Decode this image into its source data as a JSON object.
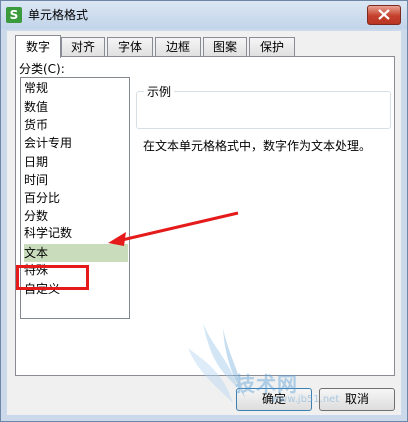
{
  "window": {
    "title": "单元格格式",
    "app_icon_glyph": "S"
  },
  "tabs": [
    {
      "label": "数字",
      "active": true
    },
    {
      "label": "对齐"
    },
    {
      "label": "字体"
    },
    {
      "label": "边框"
    },
    {
      "label": "图案"
    },
    {
      "label": "保护"
    }
  ],
  "category": {
    "label": "分类(C):",
    "items": [
      "常规",
      "数值",
      "货币",
      "会计专用",
      "日期",
      "时间",
      "百分比",
      "分数",
      "科学记数",
      "文本",
      "特殊",
      "自定义"
    ],
    "selected": "文本"
  },
  "sample": {
    "title": "示例"
  },
  "description": "在文本单元格格式中，数字作为文本处理。",
  "buttons": {
    "ok": "确定",
    "cancel": "取消"
  },
  "annotation": {
    "highlight_color": "#e51a1a"
  },
  "watermark": {
    "text": "技术网",
    "url": "www.jb51.net"
  },
  "colors": {
    "selected_bg": "#c9ddbd",
    "titlebar": "#cbd9ea"
  }
}
